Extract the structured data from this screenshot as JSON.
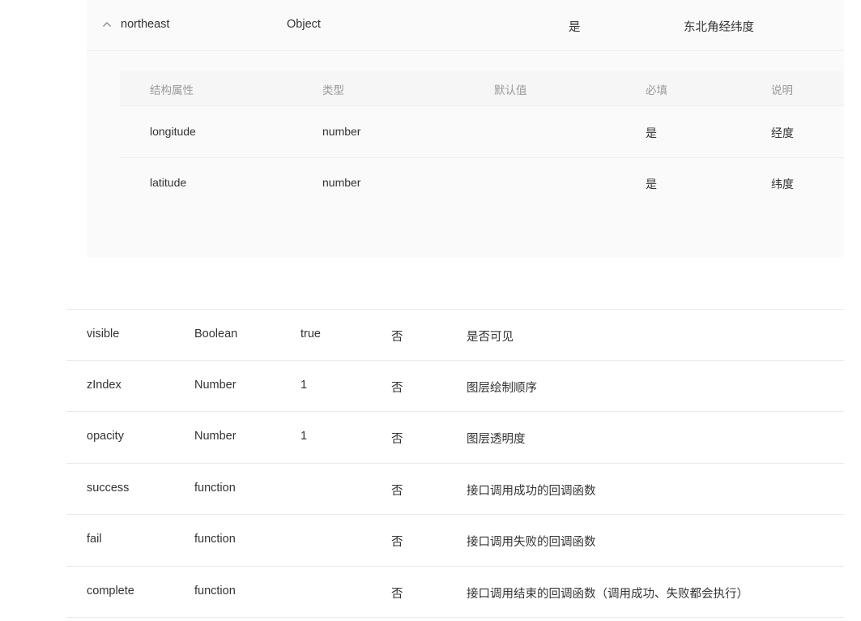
{
  "nested": {
    "parent": {
      "name": "northeast",
      "type": "Object",
      "required": "是",
      "desc": "东北角经纬度"
    },
    "headers": {
      "prop": "结构属性",
      "type": "类型",
      "default": "默认值",
      "required": "必填",
      "desc": "说明"
    },
    "rows": [
      {
        "prop": "longitude",
        "type": "number",
        "default": "",
        "required": "是",
        "desc": "经度"
      },
      {
        "prop": "latitude",
        "type": "number",
        "default": "",
        "required": "是",
        "desc": "纬度"
      }
    ]
  },
  "params": [
    {
      "name": "visible",
      "type": "Boolean",
      "default": "true",
      "required": "否",
      "desc": "是否可见"
    },
    {
      "name": "zIndex",
      "type": "Number",
      "default": "1",
      "required": "否",
      "desc": "图层绘制顺序"
    },
    {
      "name": "opacity",
      "type": "Number",
      "default": "1",
      "required": "否",
      "desc": "图层透明度"
    },
    {
      "name": "success",
      "type": "function",
      "default": "",
      "required": "否",
      "desc": "接口调用成功的回调函数"
    },
    {
      "name": "fail",
      "type": "function",
      "default": "",
      "required": "否",
      "desc": "接口调用失败的回调函数"
    },
    {
      "name": "complete",
      "type": "function",
      "default": "",
      "required": "否",
      "desc": "接口调用结束的回调函数（调用成功、失败都会执行）"
    }
  ]
}
